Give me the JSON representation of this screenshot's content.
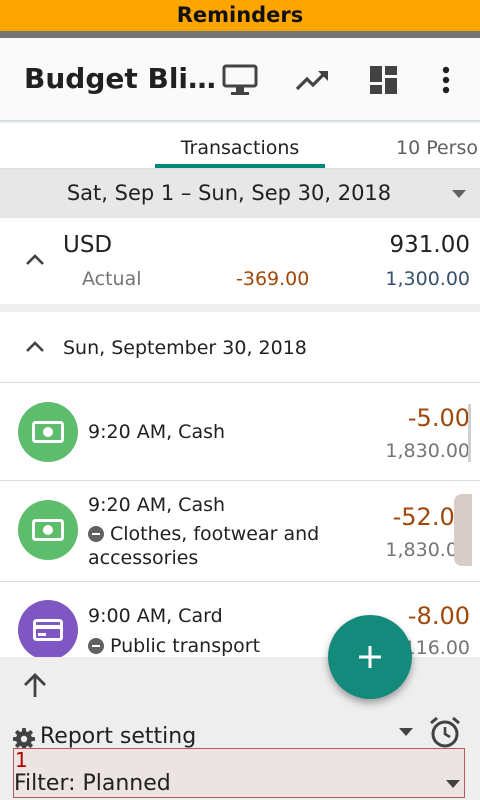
{
  "banner": {
    "title": "Reminders"
  },
  "appbar": {
    "title": "Budget Bli…"
  },
  "tabs": {
    "transactions": "Transactions",
    "persons": "10 Perso"
  },
  "date_range": {
    "label": "Sat, Sep 1 – Sun, Sep 30, 2018"
  },
  "summary": {
    "currency": "USD",
    "total": "931.00",
    "actual_label": "Actual",
    "actual_value": "-369.00",
    "planned_value": "1,300.00"
  },
  "day": {
    "label": "Sun, September 30, 2018"
  },
  "transactions": [
    {
      "title": "9:20 AM, Cash",
      "category": "",
      "amount": "-5.00",
      "balance": "1,830.00",
      "icon": "cash-icon",
      "color": "#5ebd6c"
    },
    {
      "title": "9:20 AM, Cash",
      "category": "Clothes, footwear and accessories",
      "amount": "-52.00",
      "balance": "1,830.00",
      "icon": "cash-icon",
      "color": "#5ebd6c"
    },
    {
      "title": "9:00 AM, Card",
      "category": "Public transport",
      "amount": "-8.00",
      "balance": "116.00",
      "icon": "card-icon",
      "color": "#7e57c2"
    }
  ],
  "bottom": {
    "report_label": "Report setting",
    "filter_count": "1",
    "filter_label": "Filter: Planned"
  },
  "colors": {
    "accent": "#00897b",
    "banner": "#ffa500",
    "expense": "#a0480a",
    "income": "#37506e"
  }
}
